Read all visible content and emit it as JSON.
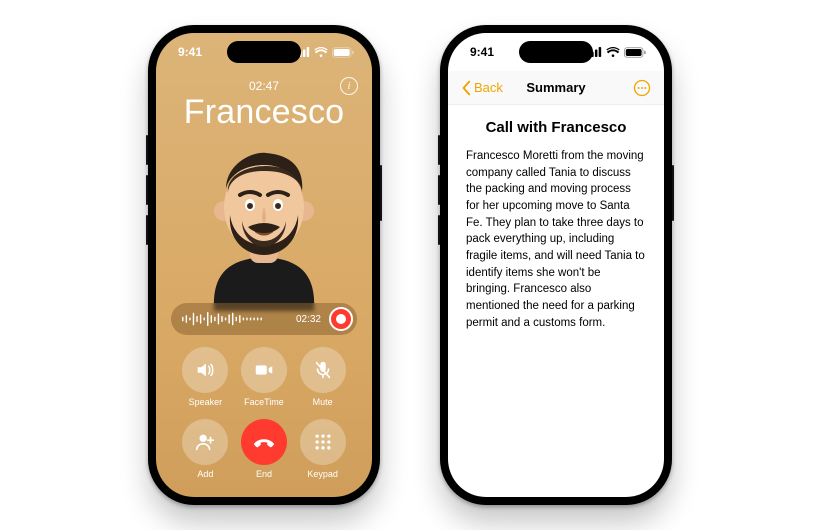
{
  "status": {
    "time": "9:41"
  },
  "call": {
    "timer": "02:47",
    "caller_name": "Francesco",
    "recording_time": "02:32",
    "controls": {
      "speaker": "Speaker",
      "facetime": "FaceTime",
      "mute": "Mute",
      "add": "Add",
      "end": "End",
      "keypad": "Keypad"
    }
  },
  "notes": {
    "back_label": "Back",
    "nav_title": "Summary",
    "title": "Call with Francesco",
    "body": "Francesco Moretti from the moving company called Tania to discuss the packing and moving process for her upcoming move to Santa Fe. They plan to take three days to pack everything up, including fragile items, and will need Tania to identify items she won't be bringing. Francesco also mentioned the need for a parking permit and a customs form."
  }
}
